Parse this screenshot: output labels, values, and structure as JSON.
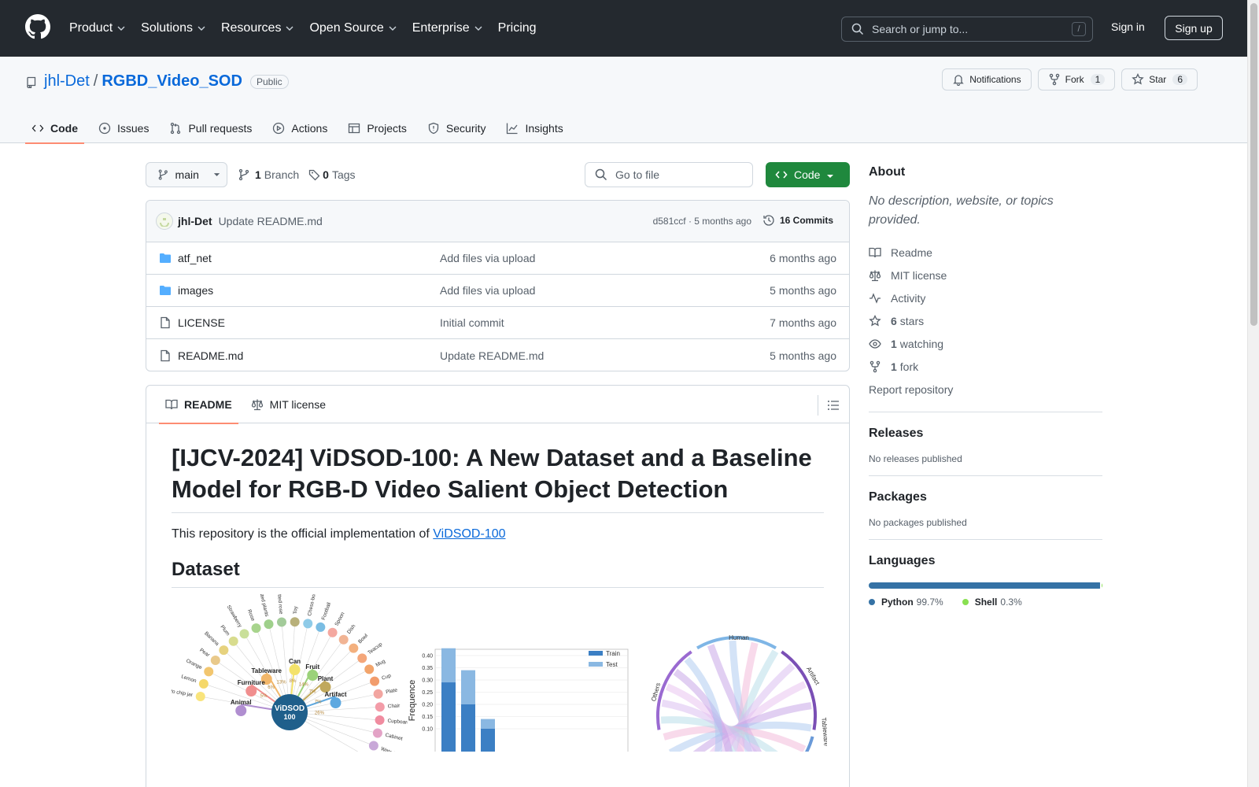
{
  "topnav": {
    "items": [
      {
        "label": "Product",
        "dropdown": true
      },
      {
        "label": "Solutions",
        "dropdown": true
      },
      {
        "label": "Resources",
        "dropdown": true
      },
      {
        "label": "Open Source",
        "dropdown": true
      },
      {
        "label": "Enterprise",
        "dropdown": true
      },
      {
        "label": "Pricing",
        "dropdown": false
      }
    ],
    "search_placeholder": "Search or jump to...",
    "search_shortcut": "/",
    "signin": "Sign in",
    "signup": "Sign up"
  },
  "repo": {
    "owner": "jhl-Det",
    "separator": "/",
    "name": "RGBD_Video_SOD",
    "visibility": "Public",
    "actions": {
      "notifications": "Notifications",
      "fork": "Fork",
      "fork_count": "1",
      "star": "Star",
      "star_count": "6"
    },
    "tabs": [
      "Code",
      "Issues",
      "Pull requests",
      "Actions",
      "Projects",
      "Security",
      "Insights"
    ]
  },
  "toolbar": {
    "branch": "main",
    "branch_count": "1",
    "branch_label": "Branch",
    "tag_count": "0",
    "tag_label": "Tags",
    "goto_placeholder": "Go to file",
    "code_button": "Code"
  },
  "latest_commit": {
    "author": "jhl-Det",
    "message": "Update README.md",
    "meta": "d581ccf · 5 months ago",
    "commits": "16 Commits"
  },
  "files": [
    {
      "name": "atf_net",
      "type": "folder",
      "message": "Add files via upload",
      "time": "6 months ago"
    },
    {
      "name": "images",
      "type": "folder",
      "message": "Add files via upload",
      "time": "5 months ago"
    },
    {
      "name": "LICENSE",
      "type": "file",
      "message": "Initial commit",
      "time": "7 months ago"
    },
    {
      "name": "README.md",
      "type": "file",
      "message": "Update README.md",
      "time": "5 months ago"
    }
  ],
  "readme": {
    "tabs": [
      "README",
      "MIT license"
    ],
    "title": "[IJCV-2024] ViDSOD-100: A New Dataset and a Baseline Model for RGB-D Video Salient Object Detection",
    "intro_text": "This repository is the official implementation of ",
    "intro_link": "ViDSOD-100",
    "section_dataset": "Dataset",
    "figure_center_label": "ViDSOD 100",
    "figure_groups": [
      "Can",
      "Fruit",
      "Tableware",
      "Plant",
      "Furniture",
      "Artifact",
      "Animal"
    ],
    "figure_items": [
      "Potato chip jar",
      "Lemon",
      "Orange",
      "Pear",
      "Banana",
      "Plum",
      "Strawberry",
      "Rose",
      "Potted plants",
      "Potted rose",
      "Toy",
      "Chess-board",
      "Football",
      "Spoon",
      "Dish",
      "Bowl",
      "Teacup",
      "Mug",
      "Cup",
      "Plate",
      "Chair",
      "Cupboard",
      "Cabinet",
      "Watering pot",
      "Rabbit"
    ],
    "figure_pcts": [
      "5%",
      "6%",
      "13%",
      "8%",
      "14%",
      "7%",
      "7%",
      "26%"
    ],
    "chord_labels": [
      "Human",
      "Artifact",
      "Others",
      "Tableware"
    ]
  },
  "bar_chart": {
    "type": "bar",
    "ylabel": "Frequence",
    "yticks": [
      "0.40",
      "0.35",
      "0.30",
      "0.25",
      "0.20",
      "0.15",
      "0.10"
    ],
    "series": [
      {
        "name": "Train",
        "values": [
          0.29,
          0.2,
          0.1
        ],
        "color": "#3b7fc4"
      },
      {
        "name": "Test",
        "values": [
          0.43,
          0.34,
          0.14
        ],
        "color": "#8ab8e2"
      }
    ]
  },
  "sidebar": {
    "about_title": "About",
    "about_desc": "No description, website, or topics provided.",
    "meta": [
      {
        "icon": "book-icon",
        "bold": "",
        "text": "Readme"
      },
      {
        "icon": "scale-icon",
        "bold": "",
        "text": "MIT license"
      },
      {
        "icon": "pulse-icon",
        "bold": "",
        "text": "Activity"
      },
      {
        "icon": "star-icon",
        "bold": "6",
        "text": "stars"
      },
      {
        "icon": "eye-icon",
        "bold": "1",
        "text": "watching"
      },
      {
        "icon": "fork-icon",
        "bold": "1",
        "text": "fork"
      }
    ],
    "report": "Report repository",
    "releases_title": "Releases",
    "releases_text": "No releases published",
    "packages_title": "Packages",
    "packages_text": "No packages published",
    "languages_title": "Languages",
    "languages": [
      {
        "name": "Python",
        "percent": "99.7%",
        "value": 99.7,
        "color": "#3572A5"
      },
      {
        "name": "Shell",
        "percent": "0.3%",
        "value": 0.3,
        "color": "#89e051"
      }
    ]
  }
}
